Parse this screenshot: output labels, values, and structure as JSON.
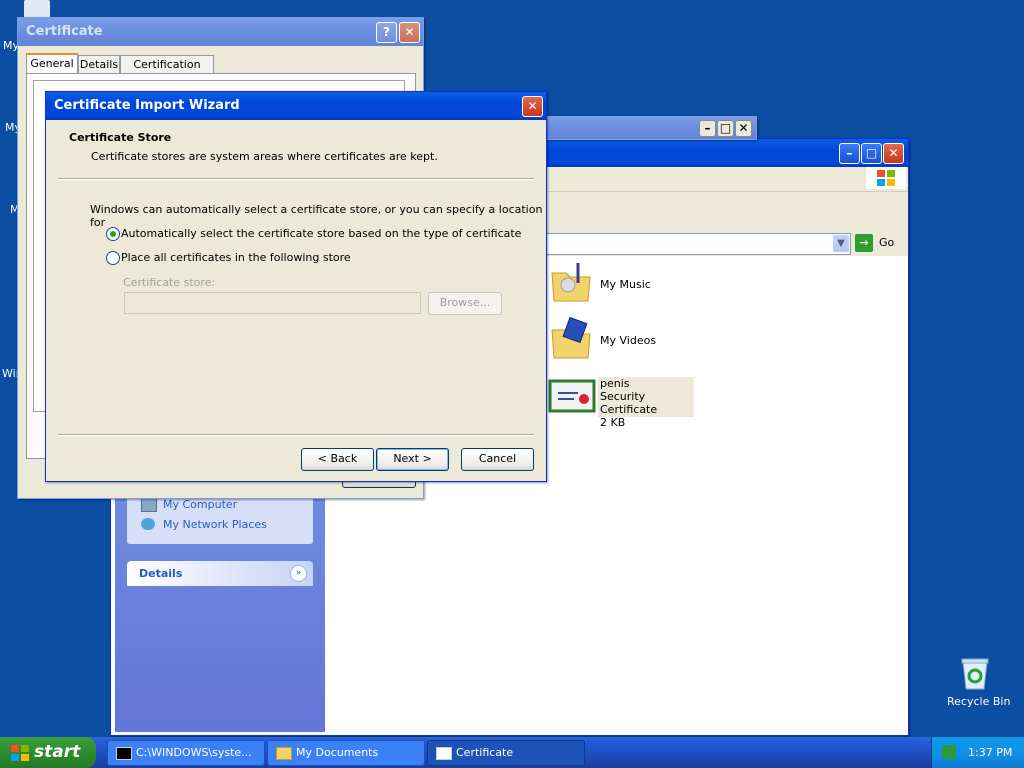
{
  "desktop": {
    "icons": [
      {
        "label": "My"
      },
      {
        "label": "My"
      },
      {
        "label": "M"
      },
      {
        "label": "Win"
      }
    ],
    "recycle_bin_label": "Recycle Bin"
  },
  "certificate_window": {
    "title": "Certificate",
    "tabs": [
      "General",
      "Details",
      "Certification Path"
    ]
  },
  "explorer": {
    "address_go_label": "Go",
    "items": [
      {
        "name": "My Music"
      },
      {
        "name": "My Videos"
      },
      {
        "name": "penis",
        "type": "Security Certificate",
        "size": "2 KB"
      }
    ],
    "other_places": [
      "My Computer",
      "My Network Places"
    ],
    "details_label": "Details"
  },
  "wizard": {
    "title": "Certificate Import Wizard",
    "header_title": "Certificate Store",
    "header_subtitle": "Certificate stores are system areas where certificates are kept.",
    "intro": "Windows can automatically select a certificate store, or you can specify a location for",
    "option_auto": "Automatically select the certificate store based on the type of certificate",
    "option_manual": "Place all certificates in the following store",
    "store_label": "Certificate store:",
    "store_value": "",
    "browse_label": "Browse...",
    "back_label": "< Back",
    "next_label": "Next >",
    "cancel_label": "Cancel"
  },
  "taskbar": {
    "start_label": "start",
    "tasks": [
      "C:\\WINDOWS\\syste...",
      "My Documents",
      "Certificate"
    ],
    "clock": "1:37 PM"
  }
}
